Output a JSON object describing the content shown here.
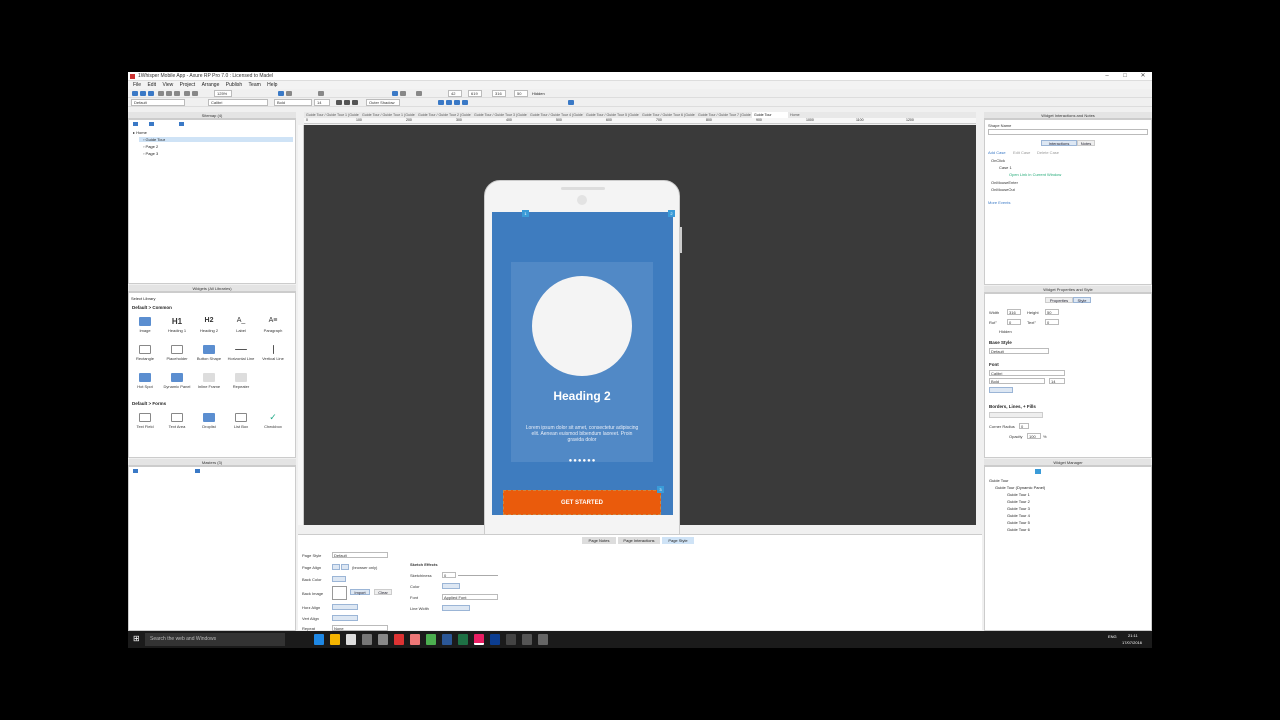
{
  "window": {
    "title": "1Whisper Mobile App - Axure RP Pro 7.0 : Licensed to Madel",
    "minimize": "–",
    "maximize": "□",
    "close": "✕"
  },
  "menu": [
    "File",
    "Edit",
    "View",
    "Project",
    "Arrange",
    "Publish",
    "Team",
    "Help"
  ],
  "toolbar1": {
    "zoom": "125%",
    "x": "42",
    "y": "619",
    "w": "316",
    "h": "50",
    "hidden_label": "Hidden"
  },
  "toolbar2": {
    "style": "Default",
    "font": "Calibri",
    "weight": "Bold",
    "size": "14",
    "outer_shadow": "Outer Shadow"
  },
  "sitemap": {
    "header": "Sitemap (4)",
    "items": [
      {
        "label": "Home",
        "indent": 0,
        "selected": false
      },
      {
        "label": "Guide Tour",
        "indent": 1,
        "selected": true
      },
      {
        "label": "Page 2",
        "indent": 1,
        "selected": false
      },
      {
        "label": "Page 3",
        "indent": 1,
        "selected": false
      }
    ]
  },
  "widgets": {
    "header": "Widgets (All Libraries)",
    "library": "Select Library",
    "section_common": "Default > Common",
    "common": [
      "Image",
      "Heading 1",
      "Heading 2",
      "Label",
      "Paragraph",
      "Rectangle",
      "Placeholder",
      "Button Shape",
      "Horizontal Line",
      "Vertical Line",
      "Hot Spot",
      "Dynamic Panel",
      "Inline Frame",
      "Repeater"
    ],
    "icon_text": {
      "Heading 1": "H1",
      "Heading 2": "H2",
      "Label": "A_",
      "Paragraph": "A≡"
    },
    "section_forms": "Default > Forms",
    "forms": [
      "Text Field",
      "Text Area",
      "Droplist",
      "List Box",
      "Checkbox"
    ]
  },
  "masters": {
    "header": "Masters (3)"
  },
  "tabs": [
    "Guide Tour / Guide Tour 1 (Guide Tour)",
    "Guide Tour / Guide Tour 1 (Guide Tour)",
    "Guide Tour / Guide Tour 2 (Guide Tour)",
    "Guide Tour / Guide Tour 3 (Guide Tour)",
    "Guide Tour / Guide Tour 4 (Guide Tour)",
    "Guide Tour / Guide Tour 5 (Guide Tour)",
    "Guide Tour / Guide Tour 6 (Guide Tour)",
    "Guide Tour / Guide Tour 7 (Guide Tour)",
    "Guide Tour",
    "Home"
  ],
  "ruler": [
    "0",
    "100",
    "200",
    "300",
    "400",
    "500",
    "600",
    "700",
    "800",
    "900",
    "1000",
    "1100",
    "1200"
  ],
  "phone": {
    "badge1": "1",
    "badge2": "2",
    "badge3": "3",
    "heading": "Heading 2",
    "body": "Lorem ipsum dolor sit amet, consectetur adipiscing elit. Aenean euismod bibendum laoreet. Proin gravida dolor",
    "dots": "●●●●●●",
    "cta": "GET STARTED"
  },
  "bottom_tabs": [
    "Page Notes",
    "Page Interactions",
    "Page Style"
  ],
  "page_style": {
    "rows": [
      "Page Style",
      "Page Align",
      "Back Color",
      "Back Image",
      "Horz Align",
      "Vert Align",
      "Repeat"
    ],
    "style_value": "Default",
    "align_note": "(browser only)",
    "import": "Import",
    "clear": "Clear",
    "repeat_value": "None",
    "sketch_title": "Sketch Effects",
    "sketch_rows": [
      "Sketchiness",
      "Color",
      "Font",
      "Line Width"
    ],
    "sketchiness": "0",
    "font_value": "Applied Font"
  },
  "interactions": {
    "header": "Widget Interactions and Notes",
    "shape_name": "Shape Name",
    "tab_interactions": "Interactions",
    "tab_notes": "Notes",
    "actions": [
      "Add Case",
      "Edit Case",
      "Delete Case"
    ],
    "tree": [
      "OnClick",
      "Case 1",
      "Open Link in Current Window",
      "OnMouseEnter",
      "OnMouseOut"
    ],
    "more": "More Events"
  },
  "properties": {
    "header": "Widget Properties and Style",
    "tab_properties": "Properties",
    "tab_style": "Style",
    "width_label": "Width",
    "width": "316",
    "height_label": "Height",
    "height": "50",
    "rot_label": "Rot°",
    "rot": "0",
    "text_label": "Text°",
    "text_rot": "0",
    "hidden": "Hidden",
    "base_style": "Base Style",
    "base_value": "Default",
    "font_section": "Font",
    "font": "Calibri",
    "weight": "Bold",
    "size": "14",
    "borders": "Borders, Lines, + Fills",
    "corner": "Corner Radius",
    "corner_value": "0",
    "opacity": "Opacity",
    "opacity_value": "100",
    "percent": "%"
  },
  "manager": {
    "header": "Widget Manager",
    "items": [
      "Guide Tour",
      "Guide Tour (Dynamic Panel)",
      "Guide Tour 1",
      "Guide Tour 2",
      "Guide Tour 3",
      "Guide Tour 4",
      "Guide Tour 5",
      "Guide Tour 6"
    ]
  },
  "taskbar": {
    "search": "Search the web and Windows",
    "time": "21:11",
    "date": "17/07/2016",
    "lang": "ENG"
  },
  "colors": {
    "accent": "#3e7cbf",
    "cta": "#ea5b0c",
    "canvas": "#3a3a3a"
  }
}
